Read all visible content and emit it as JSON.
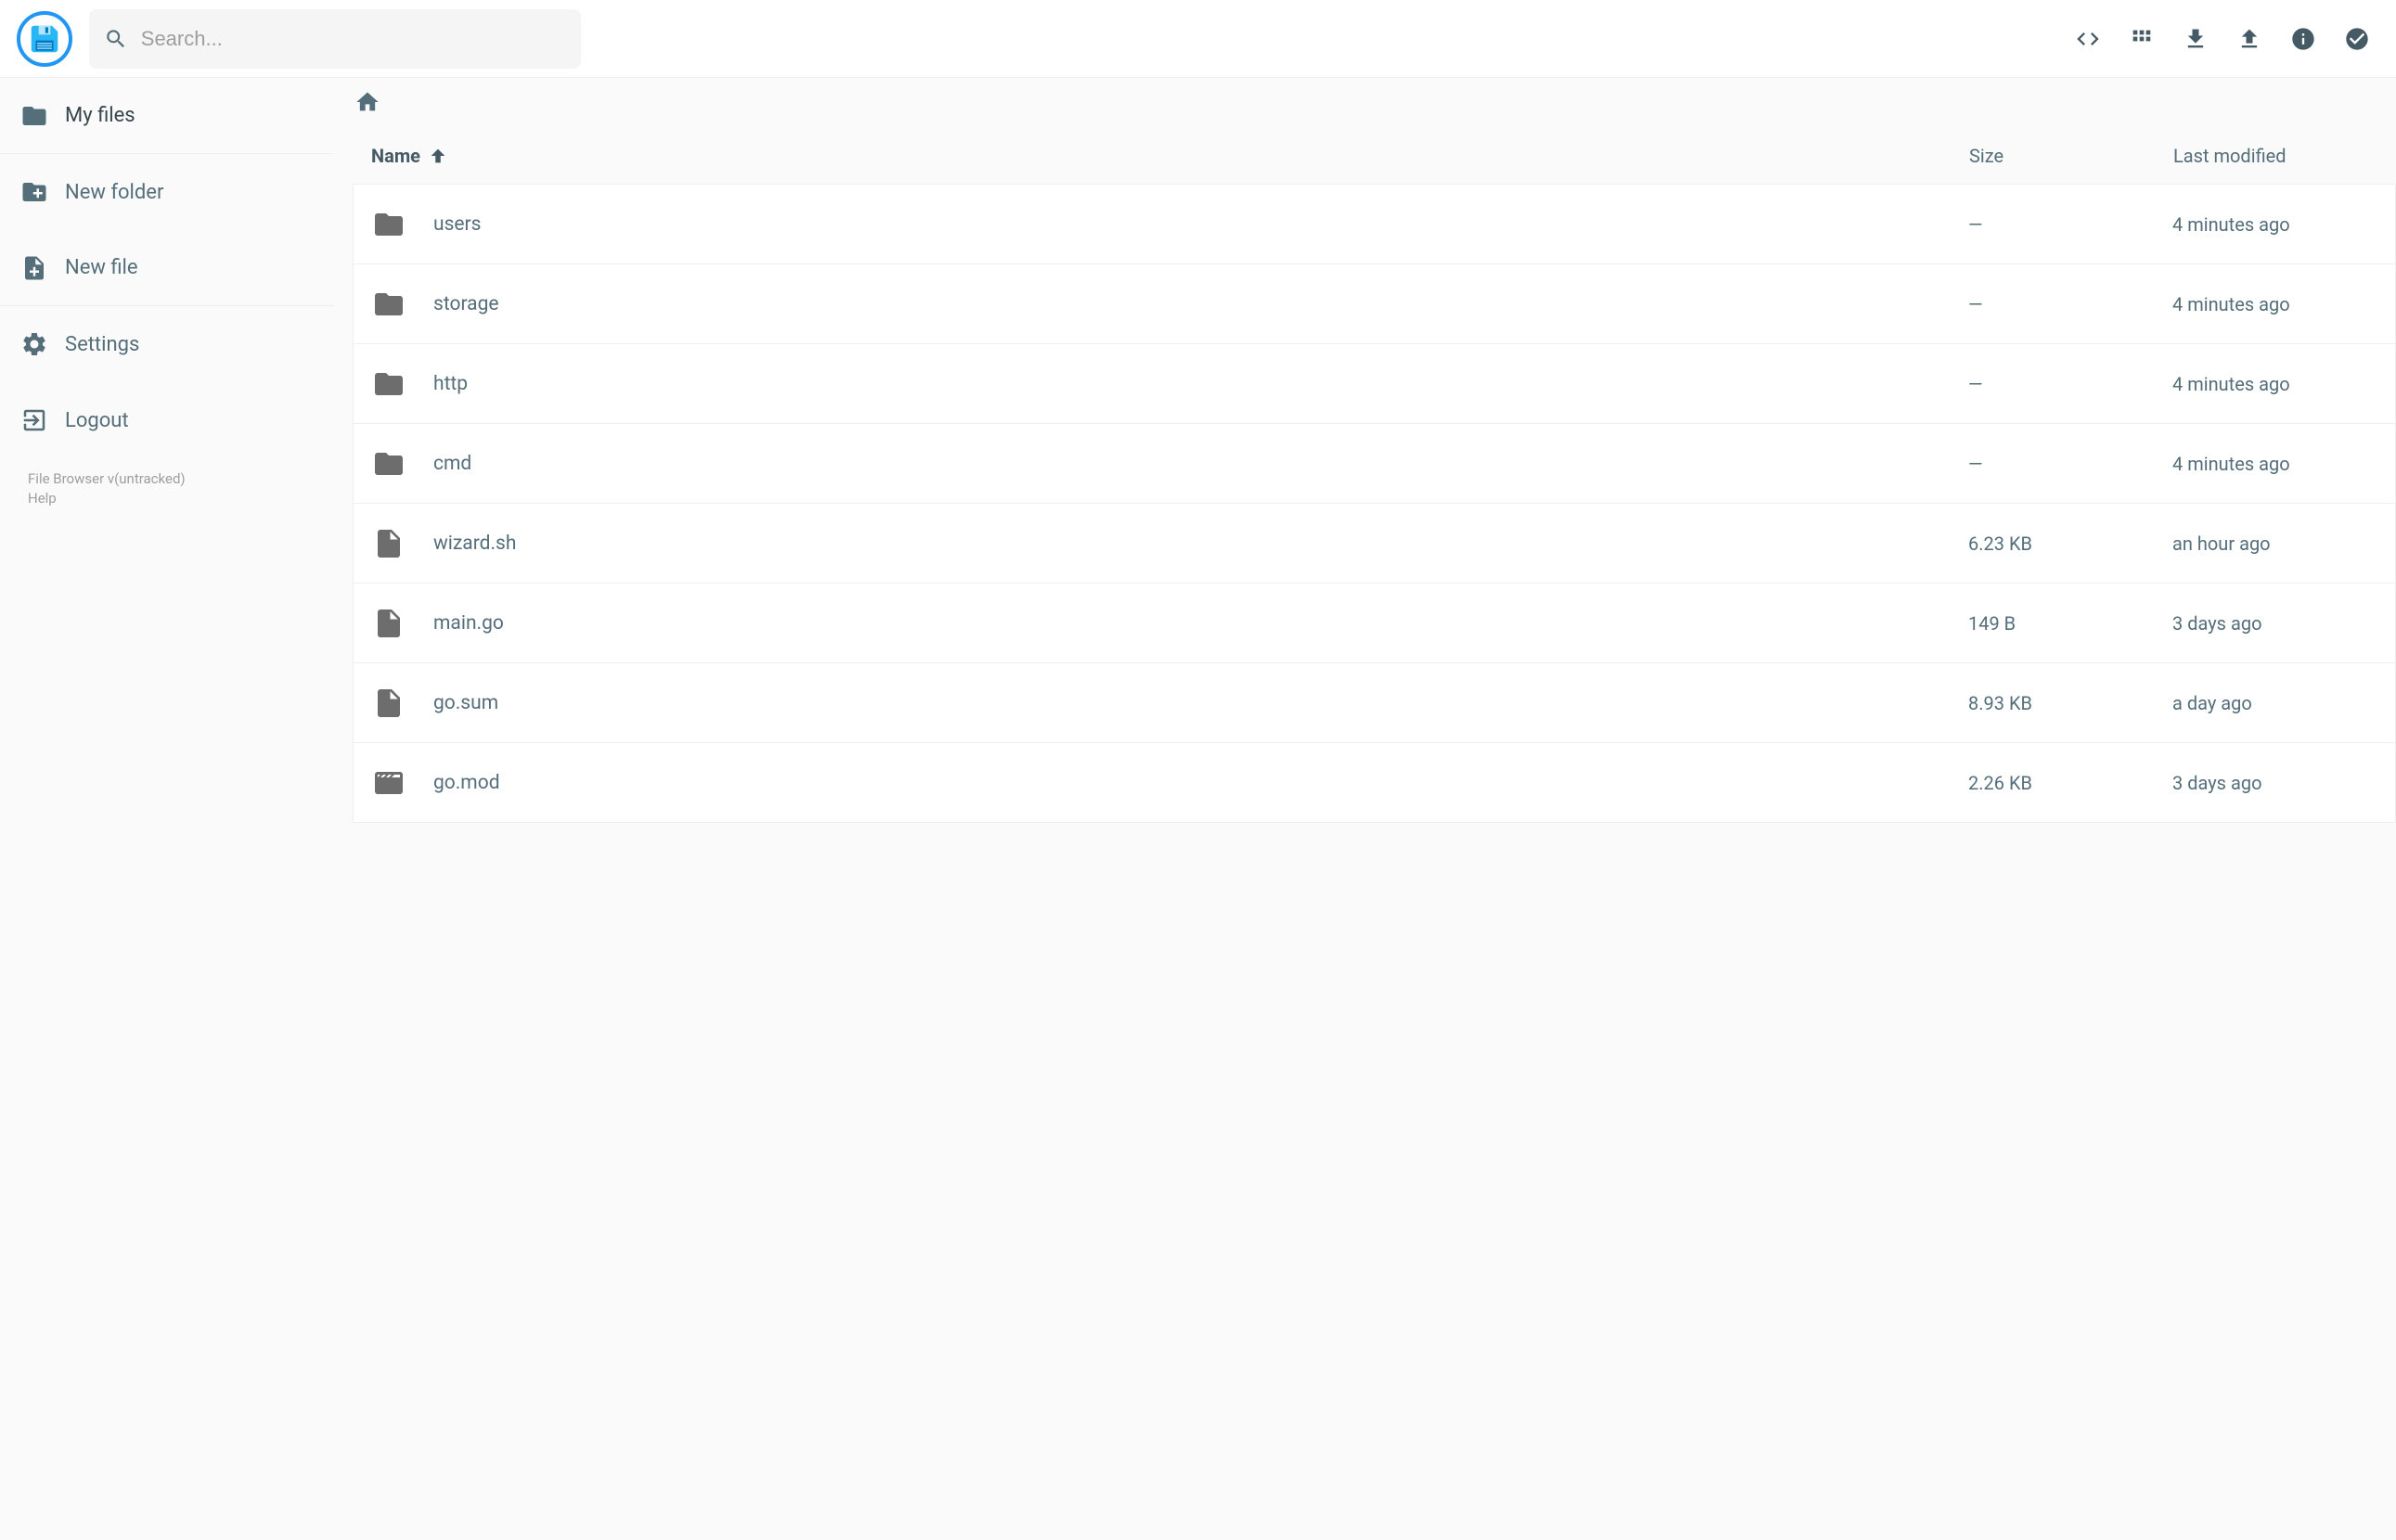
{
  "search": {
    "placeholder": "Search..."
  },
  "sidebar": {
    "items": [
      {
        "label": "My files",
        "icon": "folder"
      },
      {
        "label": "New folder",
        "icon": "folder-plus"
      },
      {
        "label": "New file",
        "icon": "file-plus"
      },
      {
        "label": "Settings",
        "icon": "gear"
      },
      {
        "label": "Logout",
        "icon": "logout"
      }
    ],
    "version": "File Browser v(untracked)",
    "help": "Help"
  },
  "columns": {
    "name": "Name",
    "size": "Size",
    "modified": "Last modified"
  },
  "files": [
    {
      "name": "users",
      "type": "folder",
      "size": "—",
      "modified": "4 minutes ago"
    },
    {
      "name": "storage",
      "type": "folder",
      "size": "—",
      "modified": "4 minutes ago"
    },
    {
      "name": "http",
      "type": "folder",
      "size": "—",
      "modified": "4 minutes ago"
    },
    {
      "name": "cmd",
      "type": "folder",
      "size": "—",
      "modified": "4 minutes ago"
    },
    {
      "name": "wizard.sh",
      "type": "file",
      "size": "6.23 KB",
      "modified": "an hour ago"
    },
    {
      "name": "main.go",
      "type": "file",
      "size": "149 B",
      "modified": "3 days ago"
    },
    {
      "name": "go.sum",
      "type": "file",
      "size": "8.93 KB",
      "modified": "a day ago"
    },
    {
      "name": "go.mod",
      "type": "movie",
      "size": "2.26 KB",
      "modified": "3 days ago"
    }
  ]
}
